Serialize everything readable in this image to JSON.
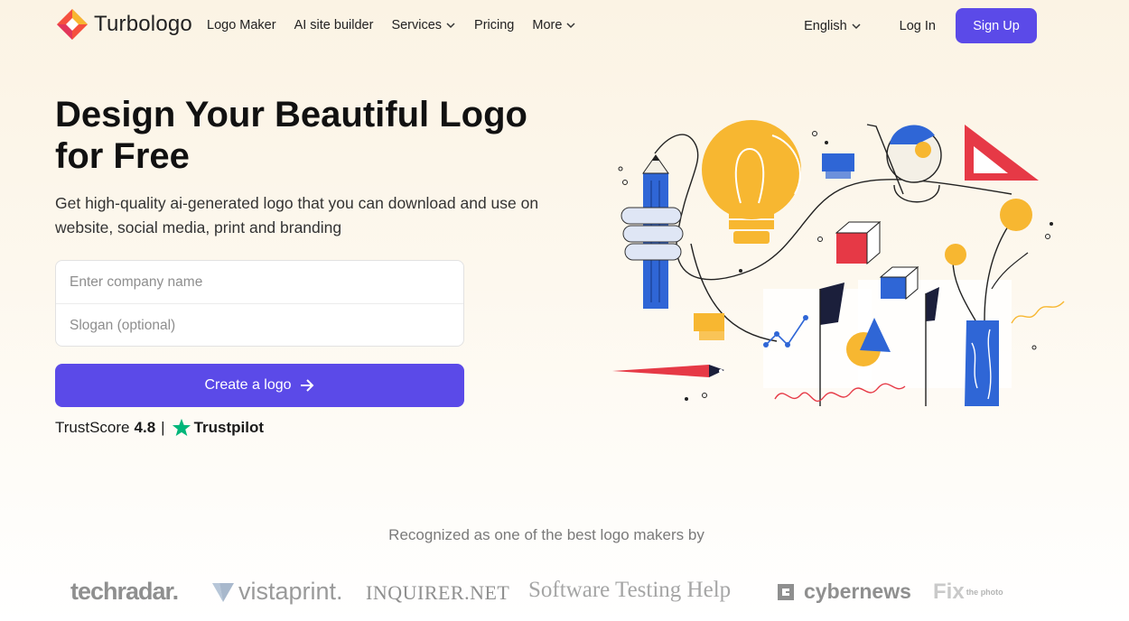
{
  "brand": {
    "name": "Turbologo"
  },
  "nav": {
    "links": [
      {
        "label": "Logo Maker",
        "dropdown": false
      },
      {
        "label": "AI site builder",
        "dropdown": false
      },
      {
        "label": "Services",
        "dropdown": true
      },
      {
        "label": "Pricing",
        "dropdown": false
      },
      {
        "label": "More",
        "dropdown": true
      }
    ],
    "language": "English",
    "login": "Log In",
    "signup": "Sign Up"
  },
  "hero": {
    "title": "Design Your Beautiful Logo for Free",
    "subtitle": "Get high-quality ai-generated logo that you can download and use on website, social media, print and branding",
    "company_placeholder": "Enter company name",
    "slogan_placeholder": "Slogan (optional)",
    "cta": "Create a logo",
    "trust_label": "TrustScore",
    "trust_score": "4.8",
    "trust_separator": "|",
    "trust_brand": "Trustpilot"
  },
  "recognized": {
    "heading": "Recognized as one of the best logo makers by",
    "partners": [
      "techradar.",
      "vistaprint.",
      "INQUIRER.NET",
      "Software Testing Help",
      "cybernews",
      "Fix",
      "the photo"
    ]
  },
  "colors": {
    "accent": "#5b4ae8",
    "trustpilot_green": "#00b67a",
    "background": "#fbf3e4"
  },
  "icons": [
    "turbologo-logo-icon",
    "chevron-down-icon",
    "arrow-right-icon",
    "trustpilot-star-icon"
  ]
}
